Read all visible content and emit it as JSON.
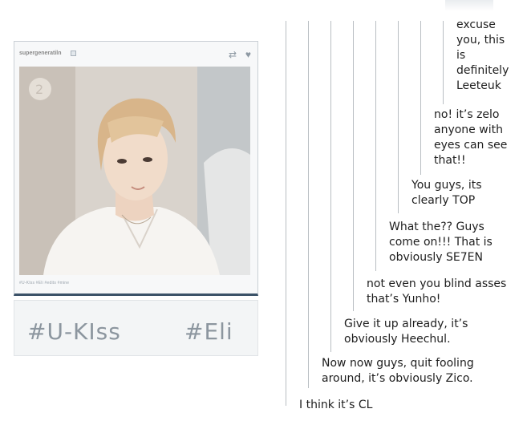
{
  "post": {
    "username": "supergeneratiln",
    "small_tags": "#U-KIss  #Eli  #edits  #mine",
    "big_tags": [
      "#U-KIss",
      "#Eli"
    ],
    "icons": {
      "follow": "follow-icon",
      "reblog": "reblog-icon",
      "like": "heart-icon"
    }
  },
  "thread": {
    "replies": [
      {
        "lines": [
          "excuse",
          "you, this",
          "is",
          "definitely",
          "Leeteuk"
        ]
      },
      {
        "lines": [
          "no! it’s zelo",
          "anyone with",
          "eyes can see",
          "that!!"
        ]
      },
      {
        "lines": [
          "You guys, its",
          "clearly TOP"
        ]
      },
      {
        "lines": [
          "What the?? Guys",
          "come on!!! That is",
          "obviously SE7EN"
        ]
      },
      {
        "lines": [
          "not even you blind asses",
          "that’s Yunho!"
        ]
      },
      {
        "lines": [
          "Give it up already, it’s",
          "obviously Heechul."
        ]
      },
      {
        "lines": [
          "Now now guys, quit fooling",
          "around, it’s obviously Zico."
        ]
      },
      {
        "lines": [
          "I think it’s CL"
        ]
      }
    ]
  }
}
